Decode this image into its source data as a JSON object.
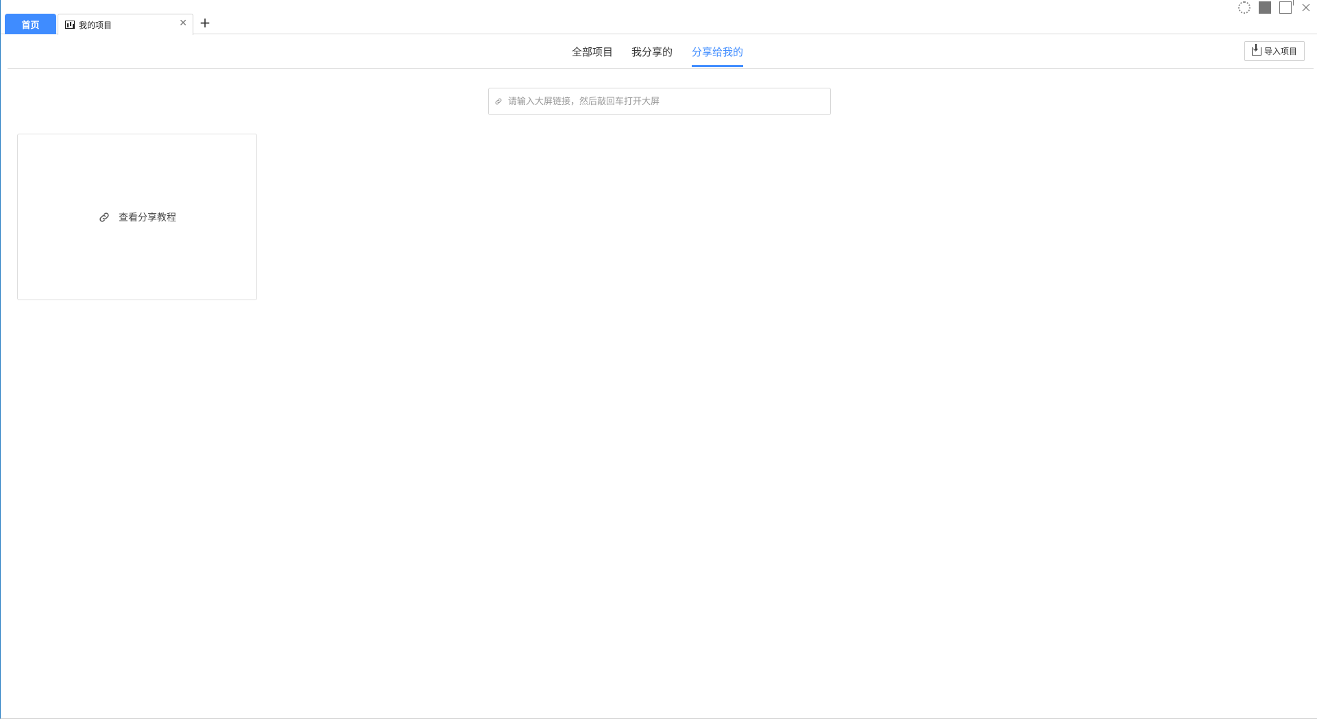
{
  "tabs": {
    "home_label": "首页",
    "doc_label": "我的项目",
    "close_symbol": "✕",
    "add_symbol": "+"
  },
  "window": {
    "minimize": "minimize-icon",
    "restore": "restore-icon",
    "close": "close-icon",
    "settings": "gear-icon"
  },
  "section_tabs": [
    {
      "label": "全部项目",
      "active": false
    },
    {
      "label": "我分享的",
      "active": false
    },
    {
      "label": "分享给我的",
      "active": true
    }
  ],
  "import_button": {
    "label": "导入项目"
  },
  "search": {
    "placeholder": "请输入大屏链接，然后敲回车打开大屏",
    "value": ""
  },
  "card": {
    "label": "查看分享教程"
  },
  "colors": {
    "accent": "#3f8cff",
    "border": "#d6d6d6"
  }
}
